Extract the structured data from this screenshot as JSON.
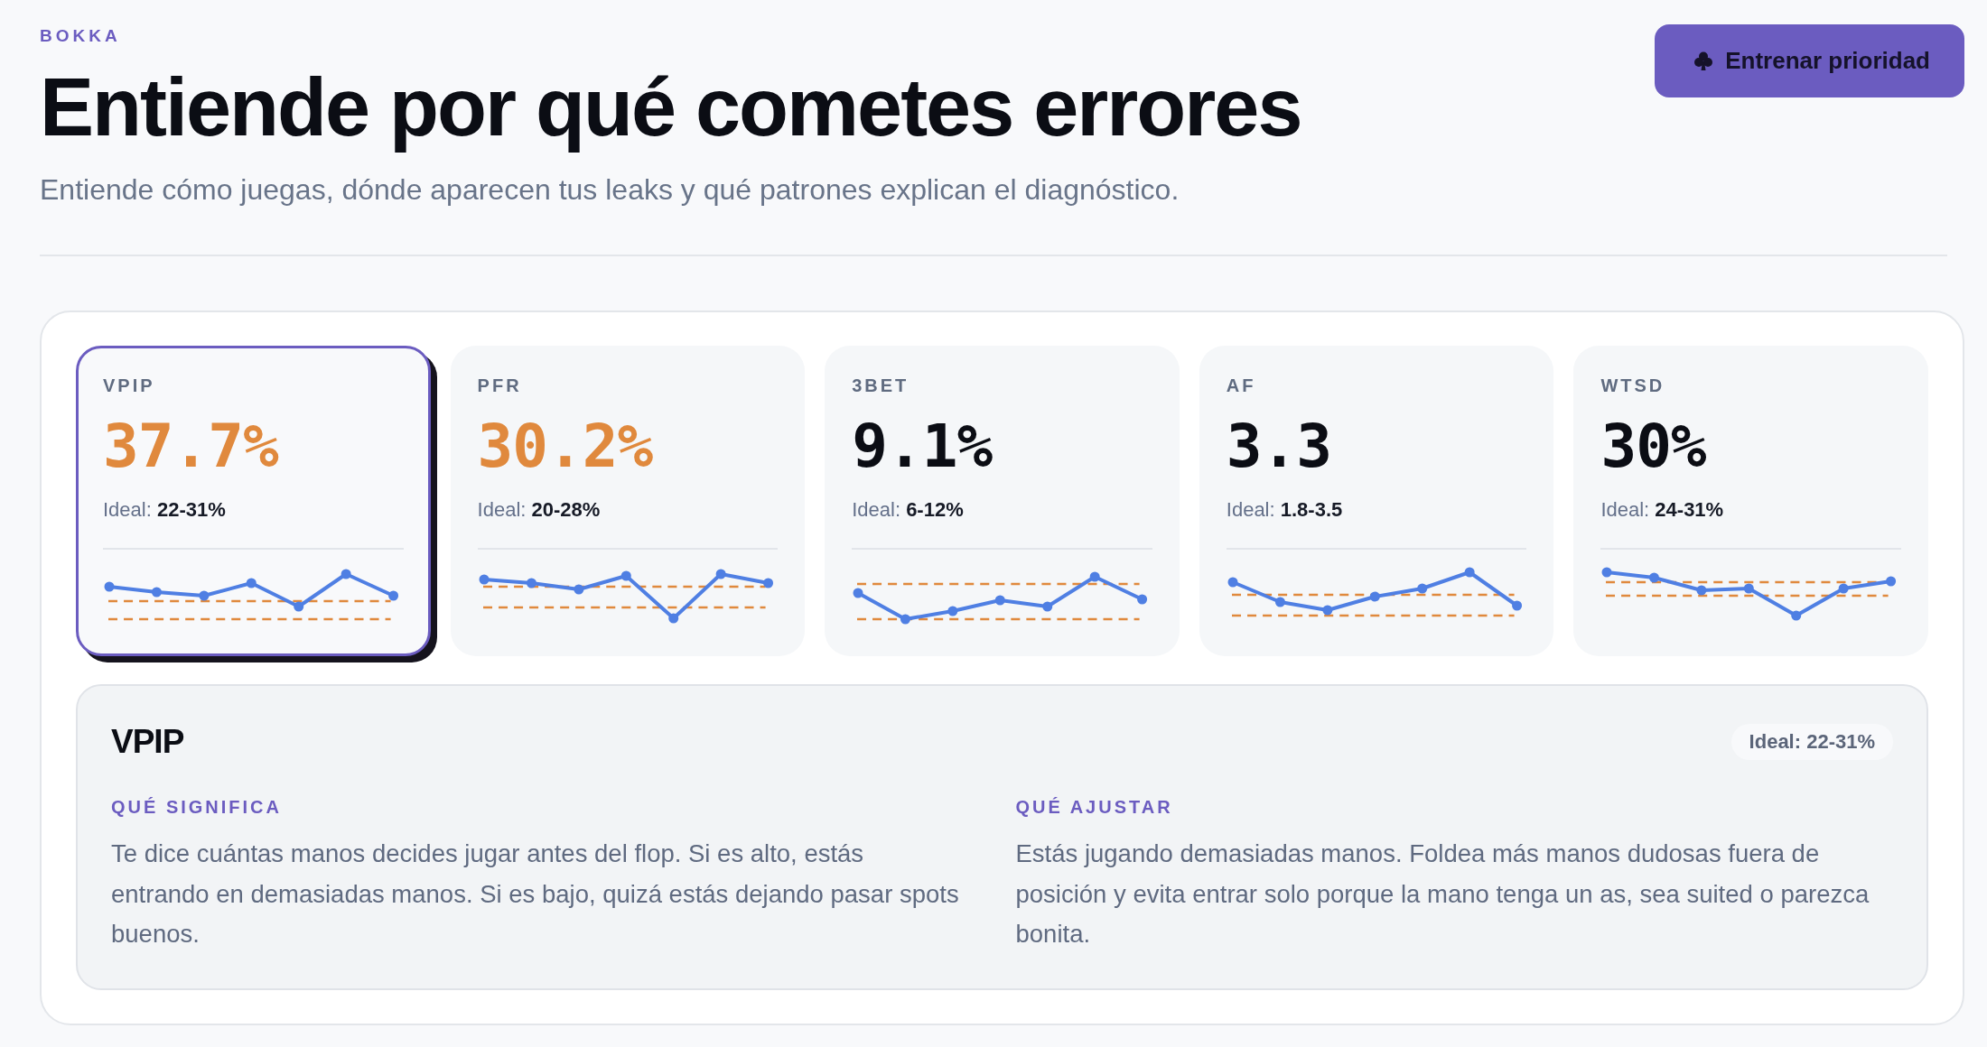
{
  "brand": "BOKKA",
  "title": "Entiende por qué cometes errores",
  "subtitle": "Entiende cómo juegas, dónde aparecen tus leaks y qué patrones explican el diagnóstico.",
  "action_button": {
    "label": "Entrenar prioridad"
  },
  "stats": [
    {
      "label": "VPIP",
      "value": "37.7%",
      "ideal": "Ideal: **22-31%**",
      "alert": true,
      "selected": true
    },
    {
      "label": "PFR",
      "value": "30.2%",
      "ideal": "Ideal: **20-28%**",
      "alert": true,
      "selected": false
    },
    {
      "label": "3BET",
      "value": "9.1%",
      "ideal": "Ideal: **6-12%**",
      "alert": false,
      "selected": false
    },
    {
      "label": "AF",
      "value": "3.3",
      "ideal": "Ideal: **1.8-3.5**",
      "alert": false,
      "selected": false
    },
    {
      "label": "WTSD",
      "value": "30%",
      "ideal": "Ideal: **24-31%**",
      "alert": false,
      "selected": false
    }
  ],
  "detail": {
    "title": "VPIP",
    "badge": "Ideal: 22-31%",
    "sections": [
      {
        "heading": "QUÉ SIGNIFICA",
        "text": "Te dice cuántas manos decides jugar antes del flop. Si es alto, estás entrando en demasiadas manos. Si es bajo, quizá estás dejando pasar spots buenos."
      },
      {
        "heading": "QUÉ AJUSTAR",
        "text": "Estás jugando demasiadas manos. Foldea más manos dudosas fuera de posición y evita entrar solo porque la mano tenga un as, sea suited o parezca bonita."
      }
    ]
  }
}
